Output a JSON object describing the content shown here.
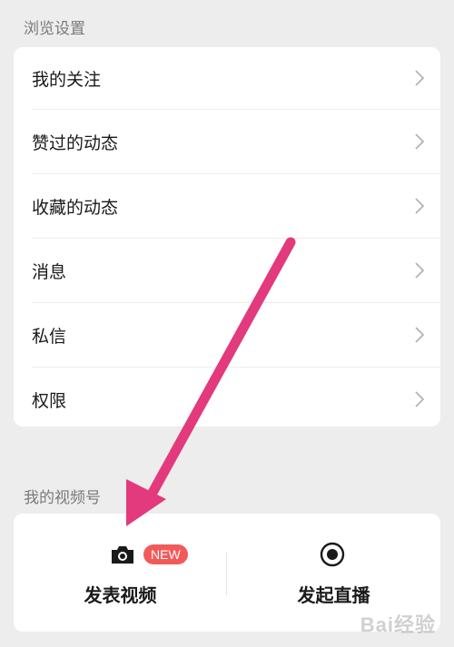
{
  "browse_settings": {
    "title": "浏览设置",
    "items": [
      {
        "label": "我的关注"
      },
      {
        "label": "赞过的动态"
      },
      {
        "label": "收藏的动态"
      },
      {
        "label": "消息"
      },
      {
        "label": "私信"
      },
      {
        "label": "权限"
      }
    ]
  },
  "channels": {
    "title": "我的视频号",
    "publish_video": {
      "label": "发表视频",
      "badge": "NEW",
      "icon": "camera-icon"
    },
    "go_live": {
      "label": "发起直播",
      "icon": "live-record-icon"
    }
  },
  "annotation": {
    "arrow_color": "#e23a7c"
  },
  "watermark": {
    "text": "Bai 经验"
  },
  "colors": {
    "badge": "#f25a5a",
    "background": "#ededed"
  }
}
